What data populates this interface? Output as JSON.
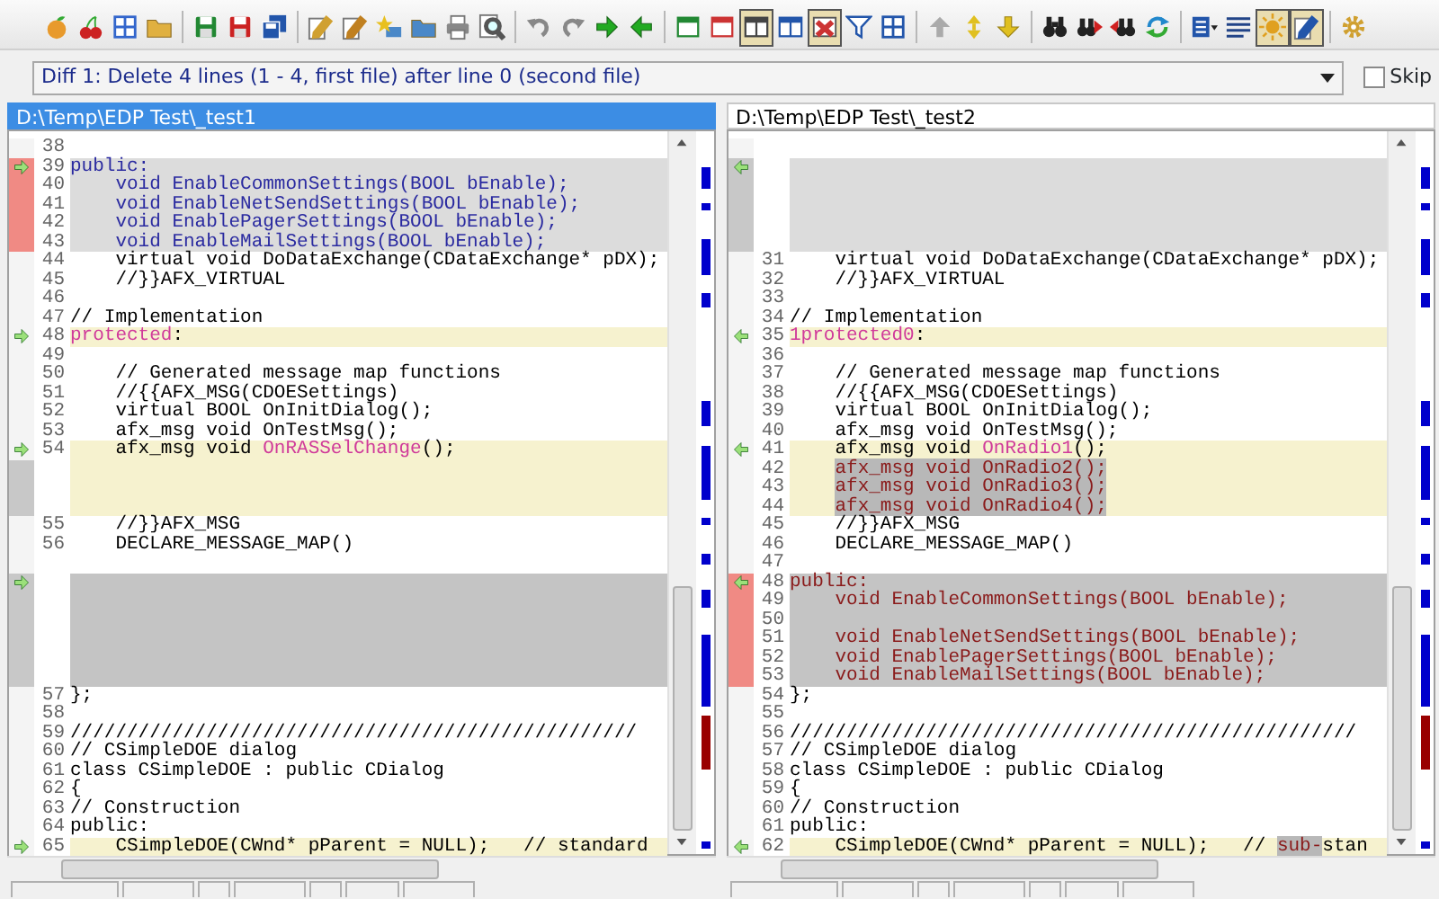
{
  "toolbar": [
    {
      "kind": "fruit",
      "color": "#e89a2c",
      "pressed": false
    },
    {
      "kind": "cherries",
      "color": "#cc2222",
      "pressed": false
    },
    {
      "kind": "grid",
      "color": "#3366cc",
      "pressed": false
    },
    {
      "kind": "folder",
      "color": "#e0b040",
      "pressed": false
    },
    {
      "kind": "separator"
    },
    {
      "kind": "floppy-disk",
      "color": "#228833",
      "pressed": false
    },
    {
      "kind": "floppy-disk",
      "color": "#cc2222",
      "pressed": false
    },
    {
      "kind": "floppy-disks",
      "color": "#2255aa",
      "pressed": false
    },
    {
      "kind": "separator"
    },
    {
      "kind": "pencil",
      "color": "#d0a030",
      "pressed": false
    },
    {
      "kind": "pencil",
      "color": "#c08020",
      "pressed": false
    },
    {
      "kind": "star",
      "color": "#e8c020",
      "pressed": false
    },
    {
      "kind": "folder",
      "color": "#4a88c8",
      "pressed": false
    },
    {
      "kind": "printer",
      "color": "#888888",
      "pressed": false
    },
    {
      "kind": "magnifier",
      "color": "#555555",
      "pressed": false
    },
    {
      "kind": "separator"
    },
    {
      "kind": "undo",
      "color": "#888888",
      "pressed": false
    },
    {
      "kind": "redo",
      "color": "#888888",
      "pressed": false
    },
    {
      "kind": "arrow-right",
      "color": "#22aa22",
      "pressed": false
    },
    {
      "kind": "arrow-left",
      "color": "#22aa22",
      "pressed": false
    },
    {
      "kind": "separator"
    },
    {
      "kind": "window",
      "color": "#228833",
      "pressed": false
    },
    {
      "kind": "window",
      "color": "#cc3333",
      "pressed": false
    },
    {
      "kind": "split-window",
      "color": "#444444",
      "pressed": true
    },
    {
      "kind": "split-window",
      "color": "#2255aa",
      "pressed": false
    },
    {
      "kind": "window-cross",
      "color": "#cc3333",
      "pressed": true
    },
    {
      "kind": "funnel",
      "color": "#2255aa",
      "pressed": false
    },
    {
      "kind": "grid",
      "color": "#2255aa",
      "pressed": false
    },
    {
      "kind": "separator"
    },
    {
      "kind": "arrow-up",
      "color": "#aaaaaa",
      "pressed": false
    },
    {
      "kind": "arrow-up-down",
      "color": "#e0c020",
      "pressed": false
    },
    {
      "kind": "arrow-down",
      "color": "#e0c020",
      "pressed": false
    },
    {
      "kind": "separator"
    },
    {
      "kind": "binoculars",
      "color": "#222222",
      "pressed": false
    },
    {
      "kind": "binoculars-next",
      "color": "#222222",
      "pressed": false
    },
    {
      "kind": "binoculars-previous",
      "color": "#222222",
      "pressed": false
    },
    {
      "kind": "refresh",
      "color": "#2288cc",
      "pressed": false
    },
    {
      "kind": "separator"
    },
    {
      "kind": "list",
      "color": "#2255aa",
      "pressed": false
    },
    {
      "kind": "lines",
      "color": "#224488",
      "pressed": false
    },
    {
      "kind": "sun",
      "color": "#e0a020",
      "pressed": true
    },
    {
      "kind": "pencil",
      "color": "#2255aa",
      "pressed": true
    },
    {
      "kind": "separator"
    },
    {
      "kind": "gear",
      "color": "#d0a030",
      "pressed": false
    }
  ],
  "diff_selector": {
    "value": "Diff 1: Delete 4 lines (1 - 4, first file) after line 0 (second file)"
  },
  "skip": {
    "label": "Skip",
    "checked": false
  },
  "panes": [
    {
      "kind": "left",
      "title": "D:\\Temp\\EDP Test\\_test1",
      "active": true,
      "lines": [
        {
          "n": "38",
          "kind": "plain"
        },
        {
          "n": "39",
          "kind": "deleted",
          "arrow": true,
          "text": "public:"
        },
        {
          "n": "40",
          "kind": "deleted",
          "text": "    void EnableCommonSettings(BOOL bEnable);"
        },
        {
          "n": "41",
          "kind": "deleted",
          "text": "    void EnableNetSendSettings(BOOL bEnable);"
        },
        {
          "n": "42",
          "kind": "deleted",
          "text": "    void EnablePagerSettings(BOOL bEnable);"
        },
        {
          "n": "43",
          "kind": "deleted",
          "text": "    void EnableMailSettings(BOOL bEnable);"
        },
        {
          "n": "44",
          "kind": "plain",
          "text": "    virtual void DoDataExchange(CDataExchange* pDX);"
        },
        {
          "n": "45",
          "kind": "plain",
          "text": "    //}}AFX_VIRTUAL"
        },
        {
          "n": "46",
          "kind": "plain"
        },
        {
          "n": "47",
          "kind": "plain",
          "text": "// Implementation"
        },
        {
          "n": "48",
          "kind": "changed",
          "arrow": true,
          "parts": [
            {
              "text": "protected",
              "kind": "word"
            },
            {
              "text": ":"
            }
          ]
        },
        {
          "n": "49",
          "kind": "plain"
        },
        {
          "n": "50",
          "kind": "plain",
          "text": "    // Generated message map functions"
        },
        {
          "n": "51",
          "kind": "plain",
          "text": "    //{{AFX_MSG(CDOESettings)"
        },
        {
          "n": "52",
          "kind": "plain",
          "text": "    virtual BOOL OnInitDialog();"
        },
        {
          "n": "53",
          "kind": "plain",
          "text": "    afx_msg void OnTestMsg();"
        },
        {
          "n": "54",
          "kind": "changed",
          "arrow": true,
          "parts": [
            {
              "text": "    afx_msg void "
            },
            {
              "text": "OnRASSelChange",
              "kind": "word"
            },
            {
              "text": "();"
            }
          ]
        },
        {
          "kind": "changed-gap"
        },
        {
          "kind": "changed-gap"
        },
        {
          "kind": "changed-gap"
        },
        {
          "n": "55",
          "kind": "plain",
          "text": "    //}}AFX_MSG"
        },
        {
          "n": "56",
          "kind": "plain",
          "text": "    DECLARE_MESSAGE_MAP()"
        },
        {
          "kind": "plain"
        },
        {
          "kind": "moved-gap",
          "arrow": true
        },
        {
          "kind": "moved-gap"
        },
        {
          "kind": "moved-gap"
        },
        {
          "kind": "moved-gap"
        },
        {
          "kind": "moved-gap"
        },
        {
          "kind": "moved-gap"
        },
        {
          "n": "57",
          "kind": "plain",
          "text": "};"
        },
        {
          "n": "58",
          "kind": "plain"
        },
        {
          "n": "59",
          "kind": "plain",
          "text": "//////////////////////////////////////////////////"
        },
        {
          "n": "60",
          "kind": "plain",
          "text": "// CSimpleDOE dialog"
        },
        {
          "n": "61",
          "kind": "plain",
          "text": "class CSimpleDOE : public CDialog"
        },
        {
          "n": "62",
          "kind": "plain",
          "text": "{"
        },
        {
          "n": "63",
          "kind": "plain",
          "text": "// Construction"
        },
        {
          "n": "64",
          "kind": "plain",
          "text": "public:"
        },
        {
          "n": "65",
          "kind": "changed",
          "arrow": true,
          "text": "    CSimpleDOE(CWnd* pParent = NULL);   // standard"
        }
      ]
    },
    {
      "kind": "right",
      "title": "D:\\Temp\\EDP Test\\_test2",
      "active": false,
      "lines": [
        {
          "kind": "plain"
        },
        {
          "kind": "gap",
          "arrow": true
        },
        {
          "kind": "gap"
        },
        {
          "kind": "gap"
        },
        {
          "kind": "gap"
        },
        {
          "kind": "gap"
        },
        {
          "n": "31",
          "kind": "plain",
          "text": "    virtual void DoDataExchange(CDataExchange* pDX);"
        },
        {
          "n": "32",
          "kind": "plain",
          "text": "    //}}AFX_VIRTUAL"
        },
        {
          "n": "33",
          "kind": "plain"
        },
        {
          "n": "34",
          "kind": "plain",
          "text": "// Implementation"
        },
        {
          "n": "35",
          "kind": "changed",
          "arrow": true,
          "parts": [
            {
              "text": "1protected0",
              "kind": "word"
            },
            {
              "text": ":"
            }
          ]
        },
        {
          "n": "36",
          "kind": "plain"
        },
        {
          "n": "37",
          "kind": "plain",
          "text": "    // Generated message map functions"
        },
        {
          "n": "38",
          "kind": "plain",
          "text": "    //{{AFX_MSG(CDOESettings)"
        },
        {
          "n": "39",
          "kind": "plain",
          "text": "    virtual BOOL OnInitDialog();"
        },
        {
          "n": "40",
          "kind": "plain",
          "text": "    afx_msg void OnTestMsg();"
        },
        {
          "n": "41",
          "kind": "changed",
          "arrow": true,
          "parts": [
            {
              "text": "    afx_msg void "
            },
            {
              "text": "OnRadio1",
              "kind": "word"
            },
            {
              "text": "();"
            }
          ]
        },
        {
          "n": "42",
          "kind": "changed",
          "parts": [
            {
              "text": "    afx_msg void OnRadio2();",
              "kind": "block"
            }
          ]
        },
        {
          "n": "43",
          "kind": "changed",
          "parts": [
            {
              "text": "    afx_msg void OnRadio3();",
              "kind": "block"
            }
          ]
        },
        {
          "n": "44",
          "kind": "changed",
          "parts": [
            {
              "text": "    afx_msg void OnRadio4();",
              "kind": "block"
            }
          ]
        },
        {
          "n": "45",
          "kind": "plain",
          "text": "    //}}AFX_MSG"
        },
        {
          "n": "46",
          "kind": "plain",
          "text": "    DECLARE_MESSAGE_MAP()"
        },
        {
          "n": "47",
          "kind": "plain"
        },
        {
          "n": "48",
          "kind": "moved",
          "arrow": true,
          "text": "public:"
        },
        {
          "n": "49",
          "kind": "moved",
          "text": "    void EnableCommonSettings(BOOL bEnable);"
        },
        {
          "n": "50",
          "kind": "moved"
        },
        {
          "n": "51",
          "kind": "moved",
          "text": "    void EnableNetSendSettings(BOOL bEnable);"
        },
        {
          "n": "52",
          "kind": "moved",
          "text": "    void EnablePagerSettings(BOOL bEnable);"
        },
        {
          "n": "53",
          "kind": "moved",
          "text": "    void EnableMailSettings(BOOL bEnable);"
        },
        {
          "n": "54",
          "kind": "plain",
          "text": "};"
        },
        {
          "n": "55",
          "kind": "plain"
        },
        {
          "n": "56",
          "kind": "plain",
          "text": "//////////////////////////////////////////////////"
        },
        {
          "n": "57",
          "kind": "plain",
          "text": "// CSimpleDOE dialog"
        },
        {
          "n": "58",
          "kind": "plain",
          "text": "class CSimpleDOE : public CDialog"
        },
        {
          "n": "59",
          "kind": "plain",
          "text": "{"
        },
        {
          "n": "60",
          "kind": "plain",
          "text": "// Construction"
        },
        {
          "n": "61",
          "kind": "plain",
          "text": "public:"
        },
        {
          "n": "62",
          "kind": "changed",
          "arrow": true,
          "parts": [
            {
              "text": "    CSimpleDOE(CWnd* pParent = NULL);   // "
            },
            {
              "text": "sub-",
              "kind": "block"
            },
            {
              "text": "stan"
            }
          ]
        }
      ]
    }
  ]
}
